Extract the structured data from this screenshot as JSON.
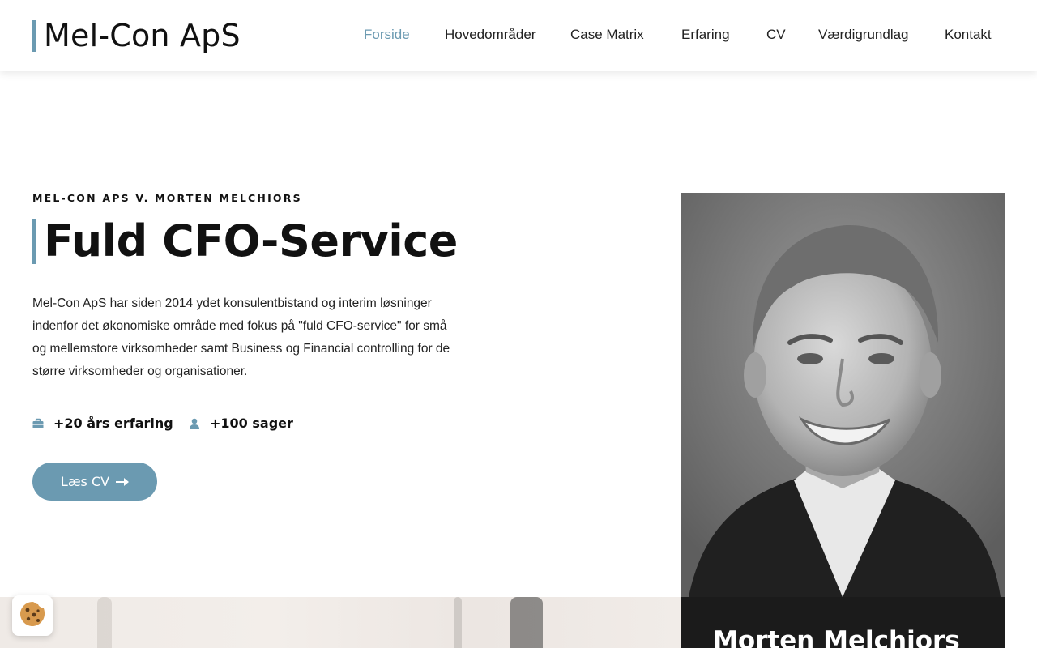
{
  "brand": {
    "name": "Mel-Con ApS",
    "accent_color": "#6b9ab1"
  },
  "nav": {
    "items": [
      {
        "label": "Forside",
        "active": true
      },
      {
        "label": "Hovedområder",
        "active": false
      },
      {
        "label": "Case Matrix",
        "active": false
      },
      {
        "label": "Erfaring",
        "active": false
      },
      {
        "label": "CV",
        "active": false
      },
      {
        "label": "Værdigrundlag",
        "active": false
      },
      {
        "label": "Kontakt",
        "active": false
      }
    ]
  },
  "hero": {
    "eyebrow": "MEL-CON APS V. MORTEN MELCHIORS",
    "title": "Fuld CFO-Service",
    "lead": "Mel-Con ApS har siden 2014 ydet konsulentbistand og interim løsninger indenfor det økonomiske område med fokus på \"fuld CFO-service\" for små og mellemstore virksomheder samt Business og Financial controlling for de større virksomheder og organisationer.",
    "stats": [
      {
        "icon": "briefcase-icon",
        "text": "+20 års erfaring"
      },
      {
        "icon": "user-icon",
        "text": "+100 sager"
      }
    ],
    "cta": {
      "label": "Læs CV",
      "icon": "arrow-right-icon"
    }
  },
  "profile": {
    "name": "Morten Melchiors",
    "photo": "portrait-photo"
  },
  "cookie": {
    "icon": "cookie-icon"
  }
}
